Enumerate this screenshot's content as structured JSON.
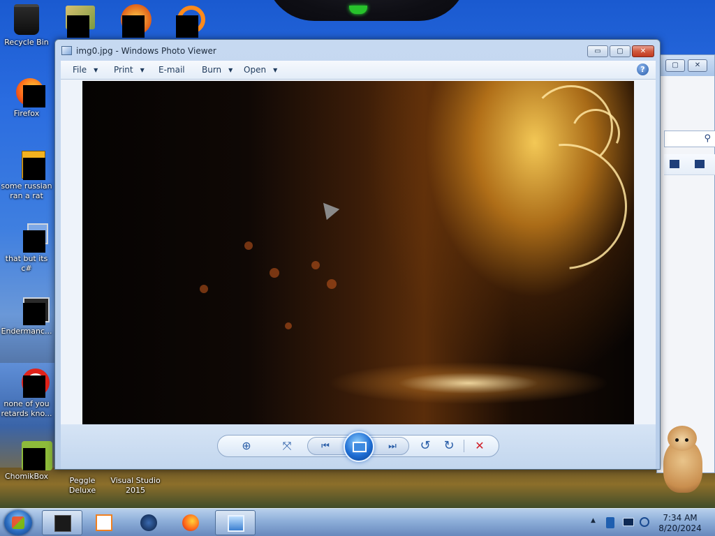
{
  "desktop": {
    "icons": [
      {
        "label": "Recycle Bin"
      },
      {
        "label": "Firefox"
      },
      {
        "label": "some russian ran a rat"
      },
      {
        "label": "that but its c#"
      },
      {
        "label": "Endermanc..."
      },
      {
        "label": "none of you retards kno..."
      },
      {
        "label": "ChomikBox"
      },
      {
        "label": "Peggle Deluxe"
      },
      {
        "label": "Visual Studio 2015"
      }
    ]
  },
  "window": {
    "title": "img0.jpg - Windows Photo Viewer",
    "minimize_glyph": "▭",
    "maximize_glyph": "▢",
    "close_glyph": "✕",
    "help_glyph": "?",
    "menu": [
      {
        "label": "File",
        "has_dropdown": true
      },
      {
        "label": "Print",
        "has_dropdown": true
      },
      {
        "label": "E-mail",
        "has_dropdown": false
      },
      {
        "label": "Burn",
        "has_dropdown": true
      },
      {
        "label": "Open",
        "has_dropdown": true
      }
    ],
    "controls": {
      "zoom_glyph": "⊕",
      "fit_glyph": "⤧",
      "prev_glyph": "⏮",
      "next_glyph": "⏭",
      "rotate_ccw_glyph": "↺",
      "rotate_cw_glyph": "↻",
      "delete_glyph": "✕"
    },
    "colors": {
      "accent": "#2a5ea8",
      "delete": "#d0202a"
    }
  },
  "taskbar": {
    "time": "7:34 AM",
    "date": "8/20/2024",
    "tray_arrow": "▲"
  }
}
